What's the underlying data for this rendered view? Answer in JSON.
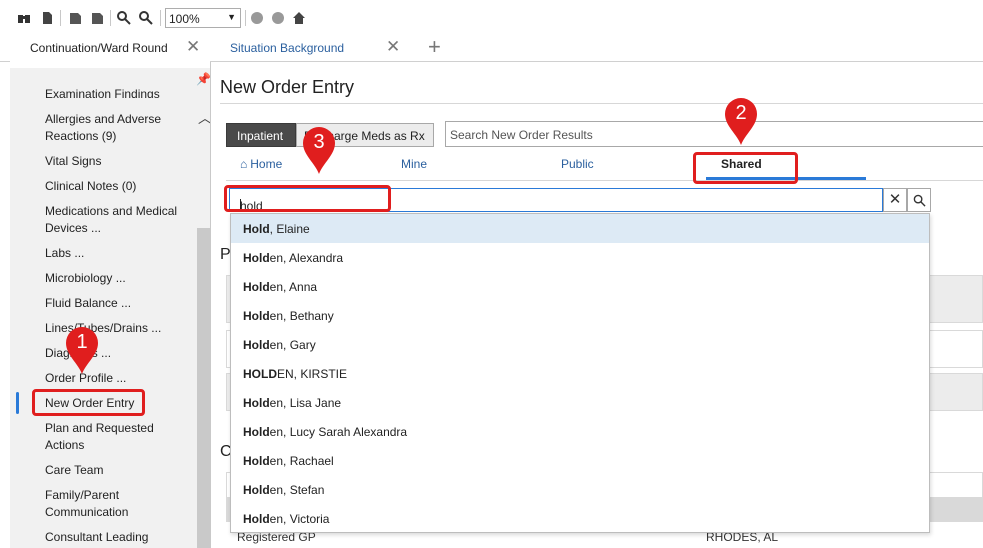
{
  "toolbar": {
    "zoom_value": "100%",
    "icons": [
      "binoculars-icon",
      "page-icon",
      "back-icon",
      "forward-icon",
      "zoom-out-icon",
      "zoom-in-icon",
      "circle-icon",
      "circle-icon",
      "home-icon"
    ]
  },
  "tabs": [
    {
      "label": "Continuation/Ward Round",
      "active": true
    },
    {
      "label": "Situation Background",
      "active": false
    }
  ],
  "sidebar": {
    "items": [
      {
        "label": "Examination Findings"
      },
      {
        "label": "Allergies and Adverse Reactions (9)"
      },
      {
        "label": "Vital Signs"
      },
      {
        "label": "Clinical Notes (0)"
      },
      {
        "label": "Medications and Medical Devices ..."
      },
      {
        "label": "Labs ..."
      },
      {
        "label": "Microbiology ..."
      },
      {
        "label": "Fluid Balance ..."
      },
      {
        "label": "Lines/Tubes/Drains ..."
      },
      {
        "label": "Diagnosis ..."
      },
      {
        "label": "Order Profile ..."
      },
      {
        "label": "New Order Entry"
      },
      {
        "label": "Plan and Requested Actions"
      },
      {
        "label": "Care Team"
      },
      {
        "label": "Family/Parent Communication"
      },
      {
        "label": "Consultant Leading"
      }
    ]
  },
  "main": {
    "title": "New Order Entry",
    "inpatient_label": "Inpatient",
    "discharge_label": "Discharge Meds as Rx",
    "search_placeholder": "Search New Order Results",
    "subtabs": [
      "Home",
      "Mine",
      "Public",
      "Shared"
    ],
    "search_value": "hold",
    "dropdown": [
      {
        "match": "Hold",
        "rest": ", Elaine"
      },
      {
        "match": "Hold",
        "rest": "en, Alexandra"
      },
      {
        "match": "Hold",
        "rest": "en, Anna"
      },
      {
        "match": "Hold",
        "rest": "en, Bethany"
      },
      {
        "match": "Hold",
        "rest": "en, Gary"
      },
      {
        "match": "HOLD",
        "rest": "EN, KIRSTIE"
      },
      {
        "match": "Hold",
        "rest": "en, Lisa Jane"
      },
      {
        "match": "Hold",
        "rest": "en, Lucy Sarah Alexandra"
      },
      {
        "match": "Hold",
        "rest": "en, Rachael"
      },
      {
        "match": "Hold",
        "rest": "en, Stefan"
      },
      {
        "match": "Hold",
        "rest": "en, Victoria"
      }
    ],
    "background": {
      "section_p": "P",
      "section_c": "C",
      "registered_gp_label": "Registered GP",
      "registered_gp_value": "RHODES, AL"
    }
  },
  "annotations": {
    "marker_1": "1",
    "marker_2": "2",
    "marker_3": "3"
  },
  "colors": {
    "accent": "#2a7ad8",
    "annotation_red": "#e01e1e",
    "highlight_row": "#ddeaf5"
  }
}
